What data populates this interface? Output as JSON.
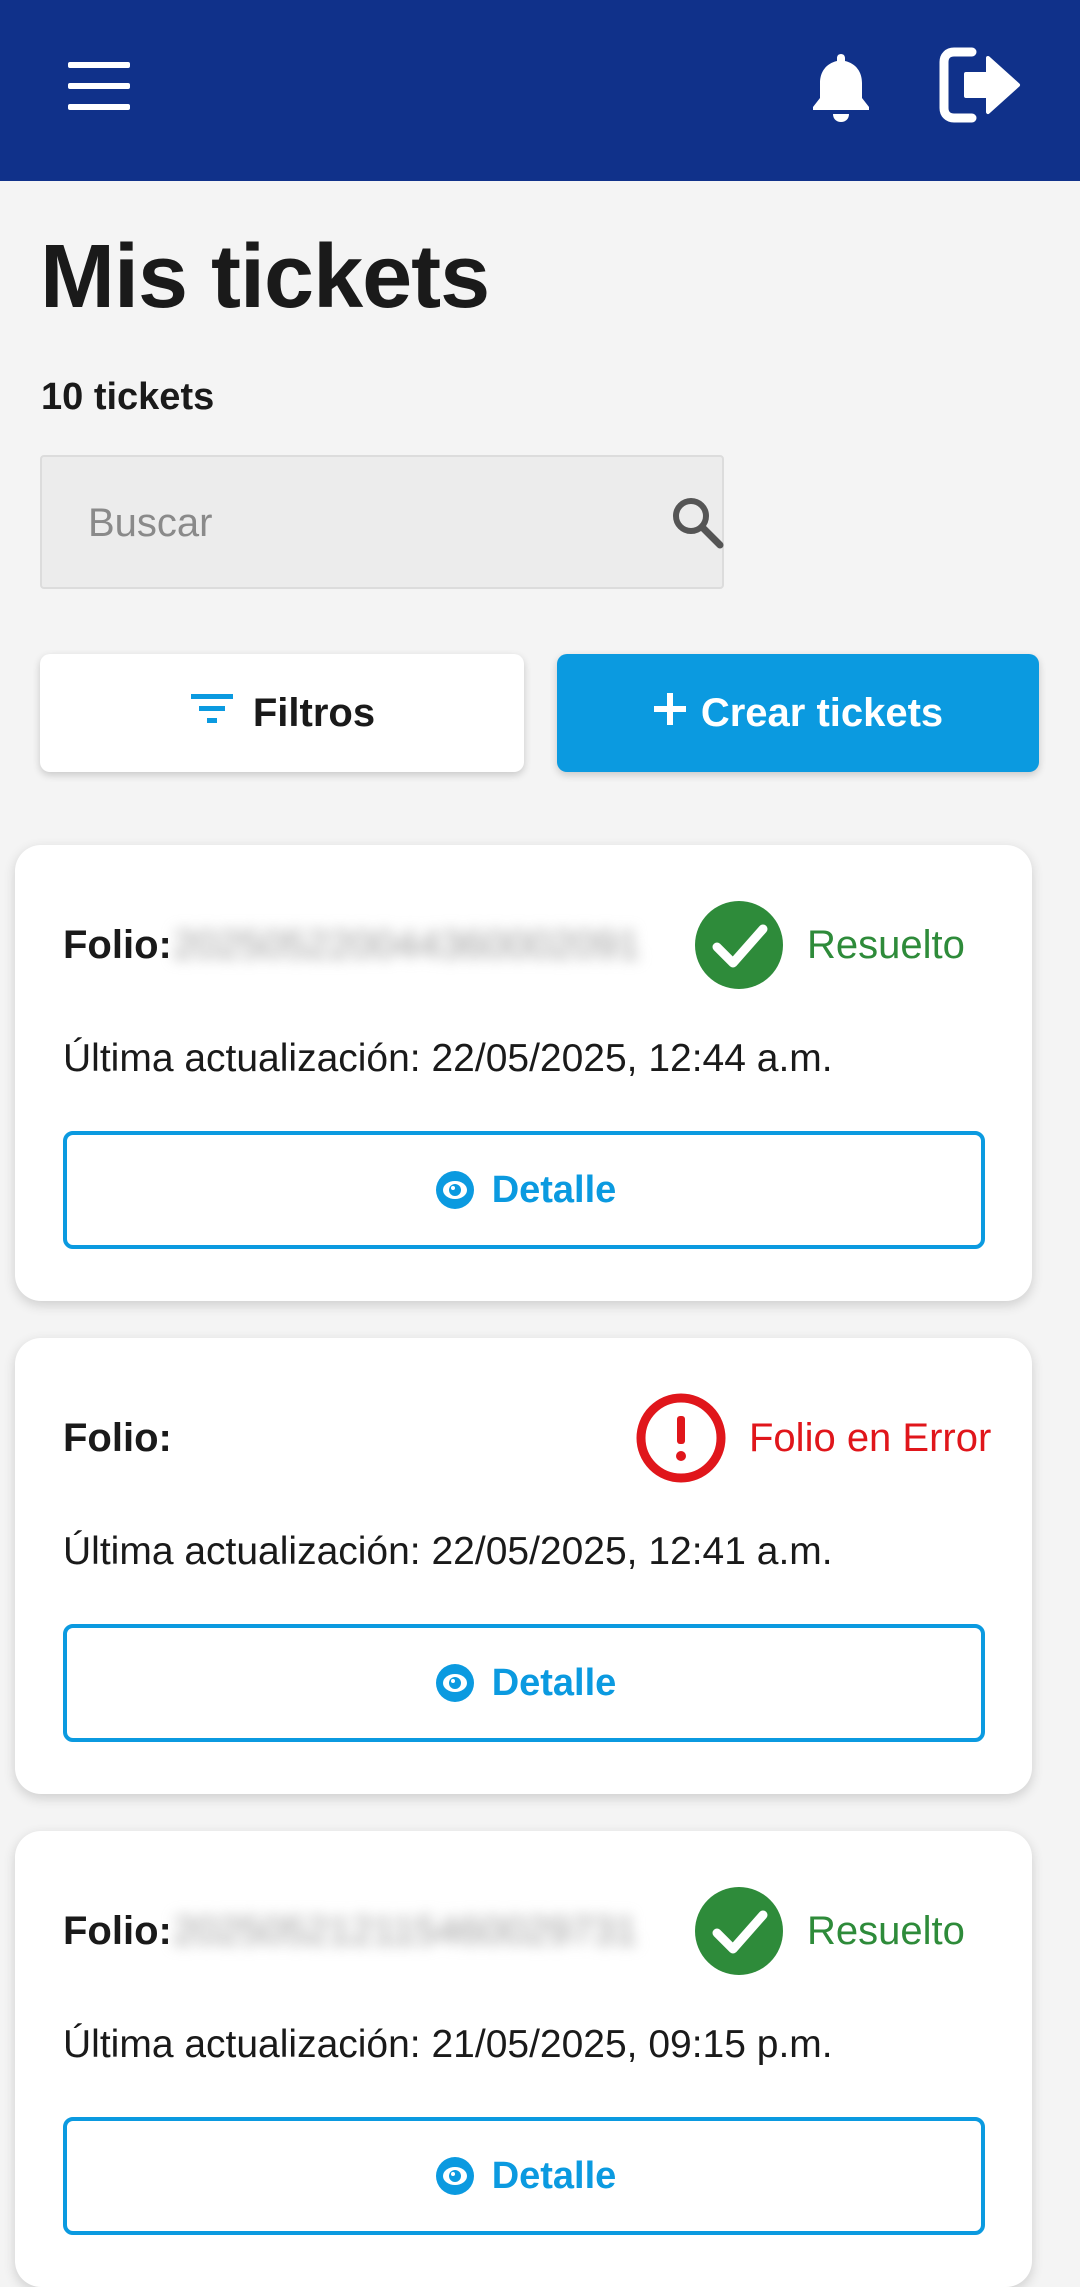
{
  "header": {
    "menu_icon": "hamburger-menu-icon",
    "notifications_icon": "bell-icon",
    "logout_icon": "logout-icon",
    "background_color": "#10318a"
  },
  "page": {
    "title": "Mis tickets",
    "count_label": "10 tickets"
  },
  "search": {
    "placeholder": "Buscar",
    "value": "",
    "icon": "search-icon"
  },
  "actions": {
    "filters_label": "Filtros",
    "filters_icon": "filter-icon",
    "create_label": "Crear tickets",
    "create_icon": "plus-icon",
    "accent_color": "#0b9ae0"
  },
  "tickets": [
    {
      "folio_label": "Folio:",
      "folio_value": "202505220044360002091",
      "status": "Resuelto",
      "status_type": "success",
      "status_color": "#2e8b3a",
      "updated": "Última actualización: 22/05/2025, 12:44 a.m.",
      "detail_label": "Detalle"
    },
    {
      "folio_label": "Folio:",
      "folio_value": "",
      "status": "Folio en Error",
      "status_type": "error",
      "status_color": "#e0161b",
      "updated": "Última actualización: 22/05/2025, 12:41 a.m.",
      "detail_label": "Detalle"
    },
    {
      "folio_label": "Folio:",
      "folio_value": "202505212115460029731",
      "status": "Resuelto",
      "status_type": "success",
      "status_color": "#2e8b3a",
      "updated": "Última actualización: 21/05/2025, 09:15 p.m.",
      "detail_label": "Detalle"
    }
  ]
}
